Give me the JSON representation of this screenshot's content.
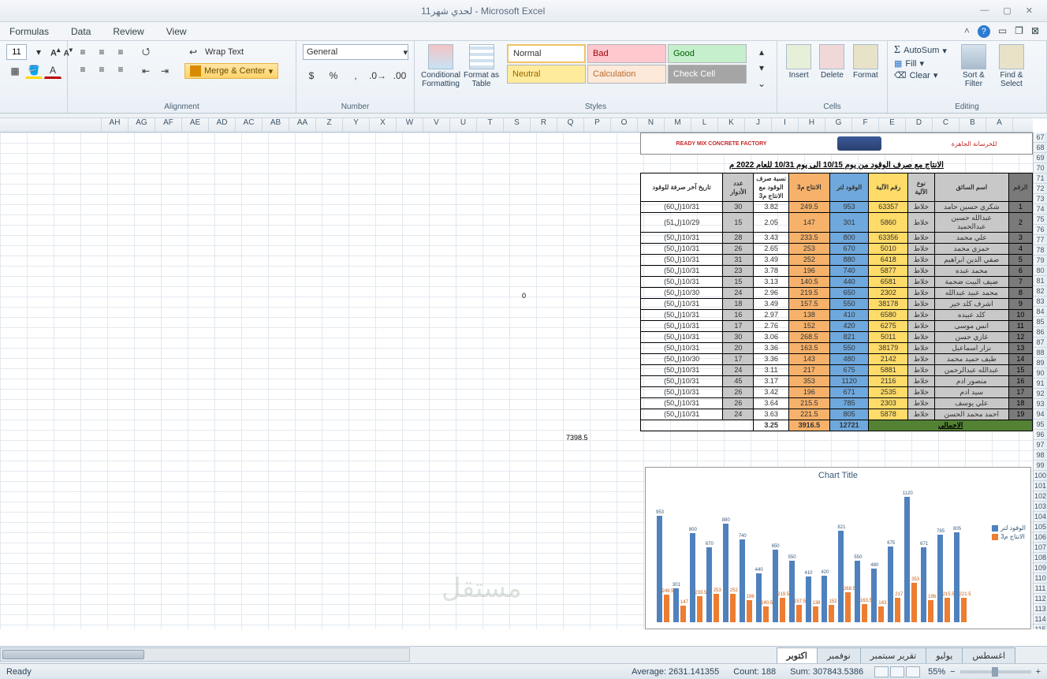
{
  "window": {
    "title": "لحدي شهر11 - Microsoft Excel"
  },
  "menu": {
    "formulas": "Formulas",
    "data": "Data",
    "review": "Review",
    "view": "View"
  },
  "ribbon": {
    "font_size": "11",
    "wrap_text": "Wrap Text",
    "merge_center": "Merge & Center",
    "alignment_label": "Alignment",
    "number_format": "General",
    "number_label": "Number",
    "cond_format": "Conditional Formatting",
    "format_table": "Format as Table",
    "styles_label": "Styles",
    "style_normal": "Normal",
    "style_bad": "Bad",
    "style_good": "Good",
    "style_neutral": "Neutral",
    "style_calc": "Calculation",
    "style_check": "Check Cell",
    "insert": "Insert",
    "delete": "Delete",
    "format": "Format",
    "cells_label": "Cells",
    "autosum": "AutoSum",
    "fill": "Fill",
    "clear": "Clear",
    "sort_filter": "Sort & Filter",
    "find_select": "Find & Select",
    "editing_label": "Editing"
  },
  "columns": [
    "",
    "A",
    "B",
    "C",
    "D",
    "E",
    "F",
    "G",
    "H",
    "I",
    "J",
    "K",
    "L",
    "M",
    "N",
    "O",
    "P",
    "Q",
    "R",
    "S",
    "T",
    "U",
    "V",
    "W",
    "X",
    "Y",
    "Z",
    "AA",
    "AB",
    "AC",
    "AD",
    "AE",
    "AF",
    "AG",
    "AH"
  ],
  "row_start": 67,
  "row_end": 116,
  "doc": {
    "logo_red": "READY MIX CONCRETE FACTORY",
    "logo_ar": "للخرسانة الجاهزة",
    "title": "الانتاج مع صرف الوقود من يوم   10/15   الى يوم   10/31   للعام 2022 م",
    "totals_label": "الاجمالي"
  },
  "headers": {
    "idx": "الرقم",
    "driver": "اسم السائق",
    "type": "نوع الآلية",
    "plate": "رقم الآلية",
    "fuel": "الوقود لتر",
    "prod": "الانتاج م3",
    "ratio": "نسبة صرف الوقود مع الانتاج م3",
    "days": "عدد الأدوار",
    "date": "تاريخ آخر صرفة للوقود"
  },
  "rows": [
    {
      "i": 1,
      "drv": "شكري حسين حامد",
      "t": "خلاط",
      "pl": "63357",
      "f": 953,
      "p": 249.5,
      "r": 3.82,
      "d": 30,
      "dt": "10/31(ل60)"
    },
    {
      "i": 2,
      "drv": "عبدالله حسين عبدالحميد",
      "t": "خلاط",
      "pl": "5860",
      "f": 301,
      "p": 147,
      "r": 2.05,
      "d": 15,
      "dt": "10/29(ل51)"
    },
    {
      "i": 3,
      "drv": "علي محمد",
      "t": "خلاط",
      "pl": "63356",
      "f": 800,
      "p": 233.5,
      "r": 3.43,
      "d": 28,
      "dt": "10/31(ل50)"
    },
    {
      "i": 4,
      "drv": "حمزي محمد",
      "t": "خلاط",
      "pl": "5010",
      "f": 670,
      "p": 253,
      "r": 2.65,
      "d": 26,
      "dt": "10/31(ل50)"
    },
    {
      "i": 5,
      "drv": "صفي الدين ابراهيم",
      "t": "خلاط",
      "pl": "6418",
      "f": 880,
      "p": 252,
      "r": 3.49,
      "d": 31,
      "dt": "10/31(ل50)"
    },
    {
      "i": 6,
      "drv": "محمد عبده",
      "t": "خلاط",
      "pl": "5877",
      "f": 740,
      "p": 196,
      "r": 3.78,
      "d": 23,
      "dt": "10/31(ل50)"
    },
    {
      "i": 7,
      "drv": "ضيف البيت ضحمة",
      "t": "خلاط",
      "pl": "6581",
      "f": 440,
      "p": 140.5,
      "r": 3.13,
      "d": 15,
      "dt": "10/31(ل50)"
    },
    {
      "i": 8,
      "drv": "محمد عبيد عبدالله",
      "t": "خلاط",
      "pl": "2302",
      "f": 650,
      "p": 219.5,
      "r": 2.96,
      "d": 24,
      "dt": "10/30(ل50)"
    },
    {
      "i": 9,
      "drv": "اشرف كلد خير",
      "t": "خلاط",
      "pl": "38178",
      "f": 550,
      "p": 157.5,
      "r": 3.49,
      "d": 18,
      "dt": "10/31(ل50)"
    },
    {
      "i": 10,
      "drv": "كلد عبيده",
      "t": "خلاط",
      "pl": "6580",
      "f": 410,
      "p": 138,
      "r": 2.97,
      "d": 16,
      "dt": "10/31(ل50)"
    },
    {
      "i": 11,
      "drv": "انس موسى",
      "t": "خلاط",
      "pl": "6275",
      "f": 420,
      "p": 152,
      "r": 2.76,
      "d": 17,
      "dt": "10/31(ل50)"
    },
    {
      "i": 12,
      "drv": "غازي حسن",
      "t": "خلاط",
      "pl": "5011",
      "f": 821,
      "p": 268.5,
      "r": 3.06,
      "d": 30,
      "dt": "10/31(ل50)"
    },
    {
      "i": 13,
      "drv": "نزار اسماعيل",
      "t": "خلاط",
      "pl": "38179",
      "f": 550,
      "p": 163.5,
      "r": 3.36,
      "d": 20,
      "dt": "10/31(ل50)"
    },
    {
      "i": 14,
      "drv": "طيف حميد محمد",
      "t": "خلاط",
      "pl": "2142",
      "f": 480,
      "p": 143,
      "r": 3.36,
      "d": 17,
      "dt": "10/30(ل50)"
    },
    {
      "i": 15,
      "drv": "عبدالله عبدالرحمن",
      "t": "خلاط",
      "pl": "5881",
      "f": 675,
      "p": 217,
      "r": 3.11,
      "d": 24,
      "dt": "10/31(ل50)"
    },
    {
      "i": 16,
      "drv": "منصور ادم",
      "t": "خلاط",
      "pl": "2116",
      "f": 1120,
      "p": 353,
      "r": 3.17,
      "d": 45,
      "dt": "10/31(ل50)"
    },
    {
      "i": 17,
      "drv": "سيد ادم",
      "t": "خلاط",
      "pl": "2535",
      "f": 671,
      "p": 196,
      "r": 3.42,
      "d": 26,
      "dt": "10/31(ل50)"
    },
    {
      "i": 18,
      "drv": "علي يوسف",
      "t": "خلاط",
      "pl": "2303",
      "f": 785,
      "p": 215.5,
      "r": 3.64,
      "d": 26,
      "dt": "10/31(ل50)"
    },
    {
      "i": 19,
      "drv": "احمد محمد الحسن",
      "t": "خلاط",
      "pl": "5878",
      "f": 805,
      "p": 221.5,
      "r": 3.63,
      "d": 24,
      "dt": "10/31(ل50)"
    }
  ],
  "totals": {
    "f": 12721,
    "p": 3916.5,
    "r": 3.25
  },
  "stray": {
    "zero": "0",
    "val": "7398.5"
  },
  "chart_data": {
    "type": "bar",
    "title": "Chart Title",
    "series": [
      {
        "name": "الوقود لتر",
        "color": "#4f81bd",
        "values": [
          953,
          301,
          800,
          670,
          880,
          740,
          440,
          650,
          550,
          410,
          420,
          821,
          550,
          480,
          675,
          1120,
          671,
          785,
          805
        ]
      },
      {
        "name": "الانتاج م3",
        "color": "#ed7d31",
        "values": [
          249.5,
          147,
          233.5,
          253,
          252,
          196,
          140.5,
          219.5,
          157.5,
          138,
          152,
          268.5,
          163.5,
          143,
          217,
          353,
          196,
          215.5,
          221.5
        ]
      }
    ],
    "ymax": 1200
  },
  "sheet_tabs": [
    "اغسطس",
    "يوليو",
    "تقرير سبتمبر",
    "نوفمبر",
    "اكتوبر"
  ],
  "active_tab": "اكتوبر",
  "status": {
    "ready": "Ready",
    "average": "Average: 2631.141355",
    "count": "Count: 188",
    "sum": "Sum: 307843.5386",
    "zoom": "55%"
  },
  "watermark": "مستقل"
}
